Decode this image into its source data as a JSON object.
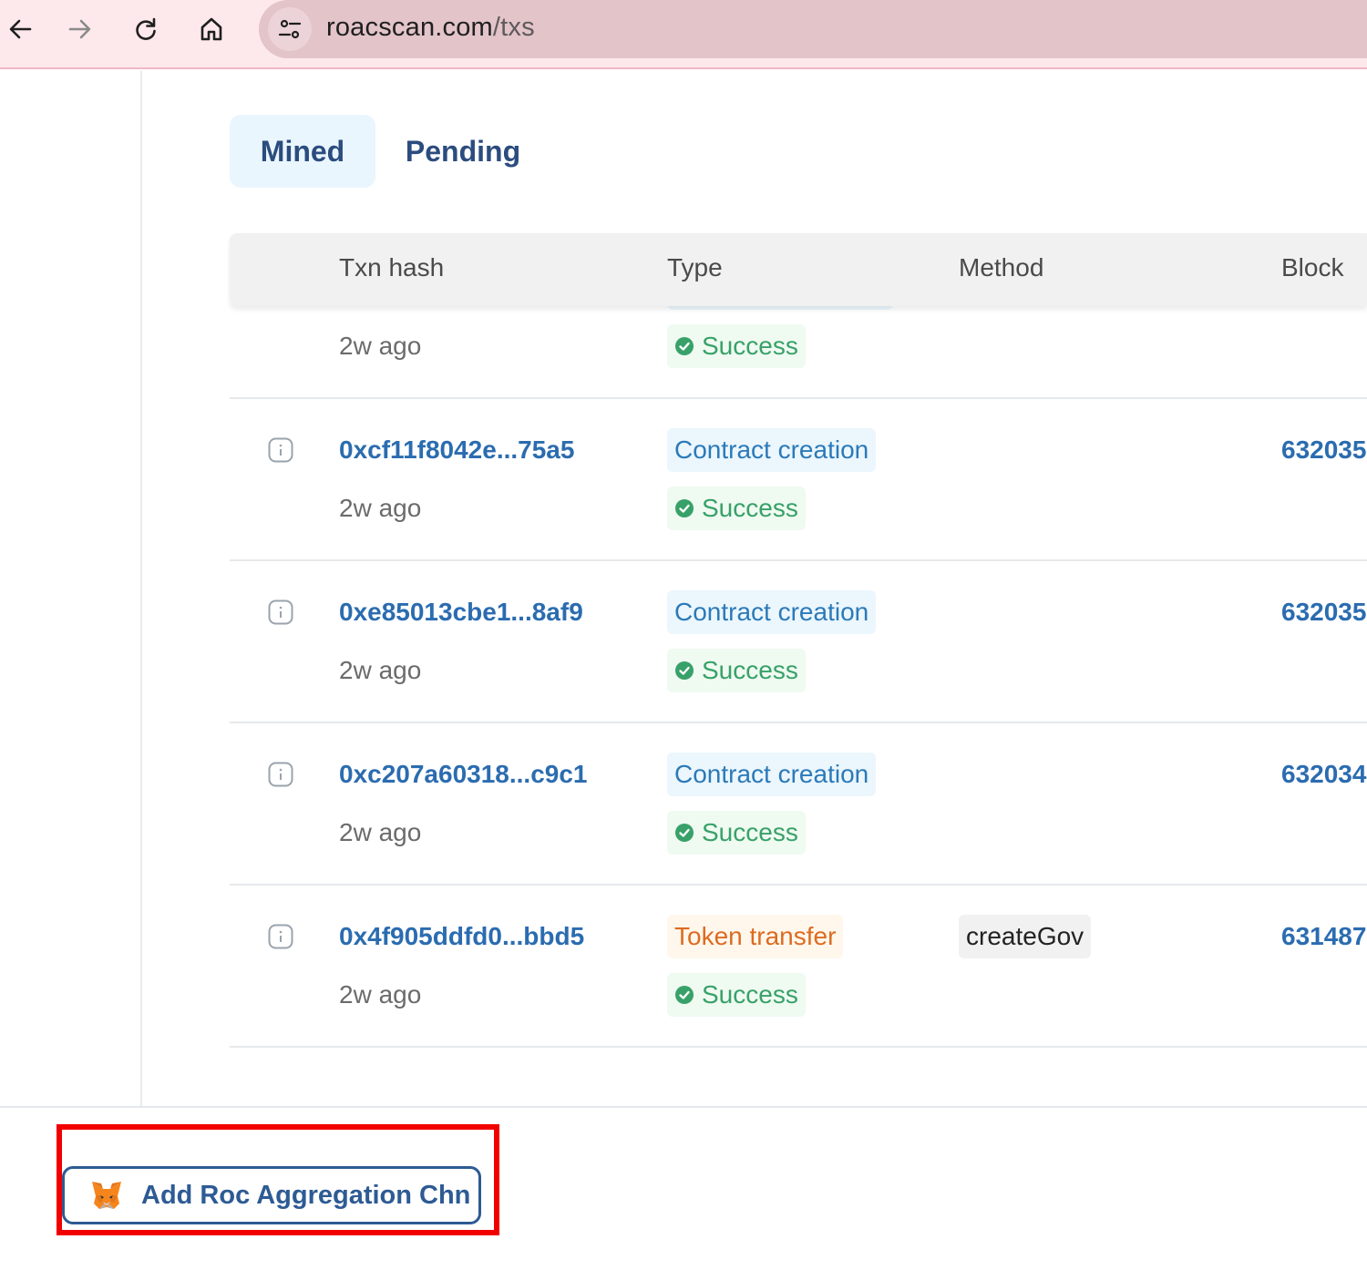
{
  "browser": {
    "url_domain": "roacscan.com",
    "url_path": "/txs",
    "icons": [
      "back-arrow-icon",
      "forward-arrow-icon",
      "reload-icon",
      "home-icon",
      "site-settings-icon"
    ]
  },
  "tabs": [
    {
      "label": "Mined",
      "active": true
    },
    {
      "label": "Pending",
      "active": false
    }
  ],
  "table": {
    "headers": [
      "Txn hash",
      "Type",
      "Method",
      "Block"
    ],
    "rows": [
      {
        "hash": "",
        "age": "2w ago",
        "type": "",
        "status": "Success",
        "method": "",
        "block": ""
      },
      {
        "hash": "0xcf11f8042e...75a5",
        "age": "2w ago",
        "type": "Contract creation",
        "status": "Success",
        "method": "",
        "block": "632035"
      },
      {
        "hash": "0xe85013cbe1...8af9",
        "age": "2w ago",
        "type": "Contract creation",
        "status": "Success",
        "method": "",
        "block": "632035"
      },
      {
        "hash": "0xc207a60318...c9c1",
        "age": "2w ago",
        "type": "Contract creation",
        "status": "Success",
        "method": "",
        "block": "632034"
      },
      {
        "hash": "0x4f905ddfd0...bbd5",
        "age": "2w ago",
        "type": "Token transfer",
        "status": "Success",
        "method": "createGov",
        "block": "631487"
      }
    ]
  },
  "footer": {
    "add_chain_label": "Add Roc Aggregation Chn",
    "add_chain_icon": "metamask-fox-icon"
  },
  "colors": {
    "accent": "#2b6cb0",
    "success": "#38a169",
    "token_transfer": "#dd6b20",
    "highlight": "#f20000"
  }
}
